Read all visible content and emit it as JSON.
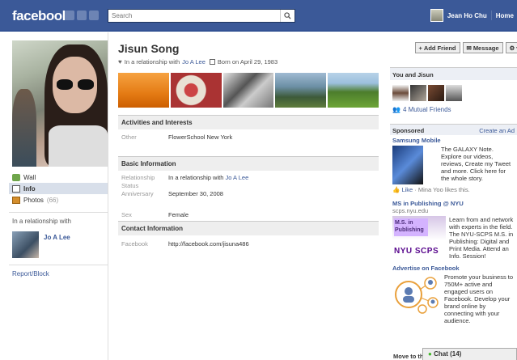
{
  "topbar": {
    "logo": "facebook",
    "search_placeholder": "Search",
    "user_name": "Jean Ho Chu",
    "home": "Home"
  },
  "profile": {
    "name": "Jisun Song",
    "relationship_prefix": "In a relationship with",
    "relationship_partner": "Jo A Lee",
    "born": "Born on April 29, 1983"
  },
  "leftnav": {
    "items": [
      {
        "label": "Wall",
        "count": ""
      },
      {
        "label": "Info",
        "count": ""
      },
      {
        "label": "Photos",
        "count": "(66)"
      }
    ],
    "relationship_heading": "In a relationship with",
    "relationship_name": "Jo A Lee",
    "report": "Report/Block"
  },
  "sections": {
    "activities": {
      "title": "Activities and Interests",
      "rows": [
        {
          "label": "Other",
          "value": "FlowerSchool New York"
        }
      ]
    },
    "basic": {
      "title": "Basic Information",
      "relationship_label": "Relationship Status",
      "relationship_prefix": "In a relationship with",
      "relationship_partner": "Jo A Lee",
      "anniversary_label": "Anniversary",
      "anniversary_value": "September 30, 2008",
      "sex_label": "Sex",
      "sex_value": "Female"
    },
    "contact": {
      "title": "Contact Information",
      "facebook_label": "Facebook",
      "facebook_value": "http://facebook.com/jisuna486"
    }
  },
  "actions": {
    "add_friend": "Add Friend",
    "message": "Message"
  },
  "you_and": {
    "title": "You and Jisun",
    "mutual": "4 Mutual Friends"
  },
  "sponsored": {
    "title": "Sponsored",
    "create": "Create an Ad",
    "ads": [
      {
        "title": "Samsung Mobile",
        "body": "The GALAXY Note. Explore our videos, reviews, Create my Tweet and more. Click here for the whole story.",
        "like_link": "Like",
        "like_text": "· Mina Yoo likes this."
      },
      {
        "title": "MS in Publishing @ NYU",
        "url": "scps.nyu.edu",
        "logo_ms": "M.S. in Publishing",
        "logo_nyu": "NYU SCPS",
        "body": "Learn from and network with experts in the field. The NYU-SCPS M.S. in Publishing: Digital and Print Media. Attend an Info. Session!"
      },
      {
        "title": "Advertise on Facebook",
        "body": "Promote your business to 750M+ active and engaged users on Facebook. Develop your brand online by connecting with your audience."
      }
    ],
    "move_to": "Move to th"
  },
  "chat": {
    "label": "Chat (14)"
  },
  "colors": {
    "brand": "#3b5998",
    "link": "#3b5998",
    "section_bg": "#eeeeee"
  }
}
